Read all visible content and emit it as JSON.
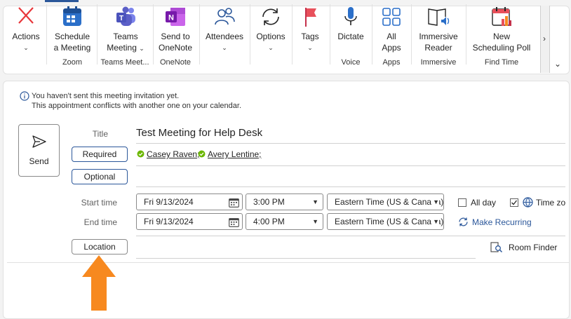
{
  "ribbon": {
    "buttons": [
      {
        "id": "actions",
        "label1": "Actions",
        "label2": ""
      },
      {
        "id": "schedule",
        "label1": "Schedule",
        "label2": "a Meeting"
      },
      {
        "id": "teams",
        "label1": "Teams",
        "label2": "Meeting"
      },
      {
        "id": "onenote",
        "label1": "Send to",
        "label2": "OneNote"
      },
      {
        "id": "attendees",
        "label1": "Attendees",
        "label2": ""
      },
      {
        "id": "options",
        "label1": "Options",
        "label2": ""
      },
      {
        "id": "tags",
        "label1": "Tags",
        "label2": ""
      },
      {
        "id": "dictate",
        "label1": "Dictate",
        "label2": ""
      },
      {
        "id": "allapps",
        "label1": "All",
        "label2": "Apps"
      },
      {
        "id": "immersive",
        "label1": "Immersive",
        "label2": "Reader"
      },
      {
        "id": "poll",
        "label1": "New",
        "label2": "Scheduling Poll"
      }
    ],
    "groups": [
      "Zoom",
      "Teams Meet...",
      "OneNote",
      "Voice",
      "Apps",
      "Immersive",
      "Find Time"
    ]
  },
  "info": {
    "line1": "You haven't sent this meeting invitation yet.",
    "line2": "This appointment conflicts with another one on your calendar."
  },
  "form": {
    "send_label": "Send",
    "title_label": "Title",
    "title_value": "Test Meeting for Help Desk",
    "required_label": "Required",
    "optional_label": "Optional",
    "attendees": [
      "Casey Raven;",
      "Avery Lentine;"
    ],
    "start_label": "Start time",
    "end_label": "End time",
    "start_date": "Fri 9/13/2024",
    "start_time": "3:00 PM",
    "end_date": "Fri 9/13/2024",
    "end_time": "4:00 PM",
    "timezone": "Eastern Time (US & Canada)",
    "allday_label": "All day",
    "allday_checked": false,
    "timezones_label": "Time zo",
    "timezones_checked": true,
    "recurring_label": "Make Recurring",
    "location_label": "Location",
    "roomfinder_label": "Room Finder"
  },
  "colors": {
    "accent": "#2b579a",
    "arrow": "#f7891f",
    "presence": "#6bb700",
    "onenote": "#7719aa",
    "teams": "#5b5fc7",
    "actions_x": "#e8373b"
  }
}
